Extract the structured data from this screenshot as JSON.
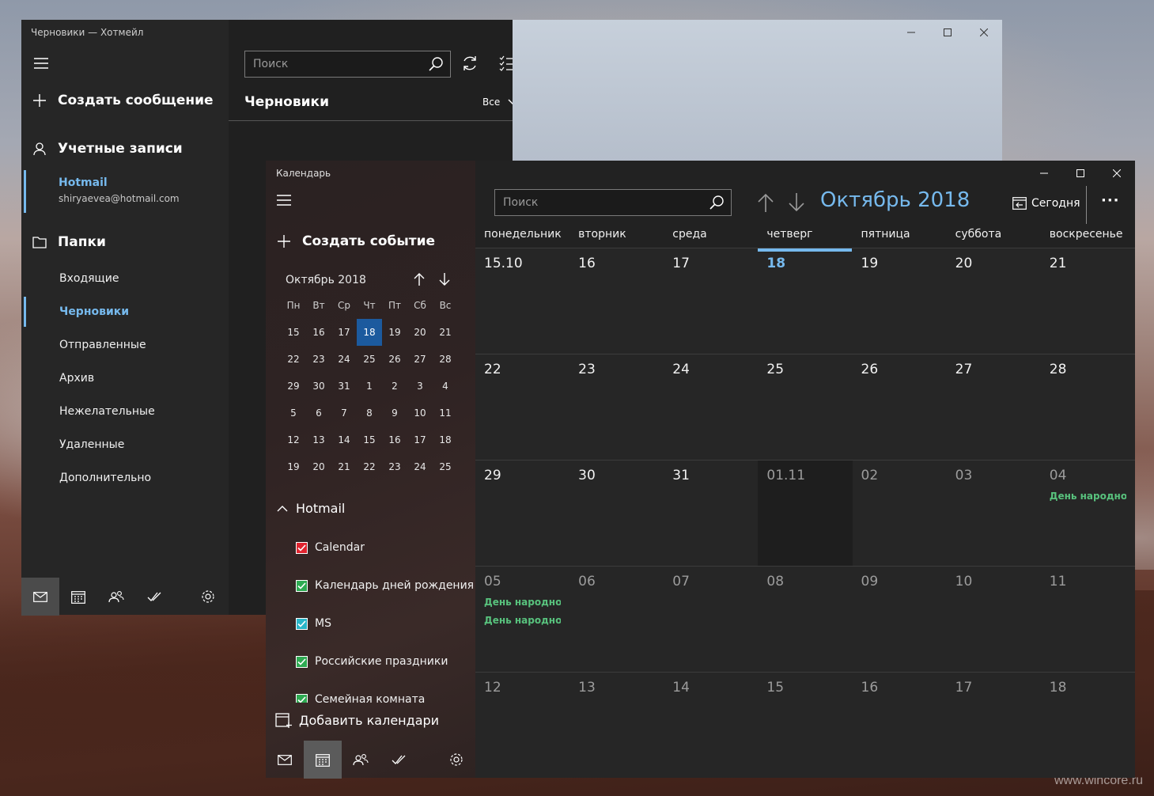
{
  "watermark": "www.wincore.ru",
  "mail": {
    "window_title": "Черновики — Хотмейл",
    "compose_label": "Создать сообщение",
    "accounts_label": "Учетные записи",
    "account": {
      "name": "Hotmail",
      "email": "shiryaevea@hotmail.com"
    },
    "folders_label": "Папки",
    "folders": [
      {
        "label": "Входящие",
        "active": false
      },
      {
        "label": "Черновики",
        "active": true
      },
      {
        "label": "Отправленные",
        "active": false
      },
      {
        "label": "Архив",
        "active": false
      },
      {
        "label": "Нежелательные",
        "active": false
      },
      {
        "label": "Удаленные",
        "active": false
      },
      {
        "label": "Дополнительно",
        "active": false
      }
    ],
    "search_placeholder": "Поиск",
    "folder_title": "Черновики",
    "filter_label": "Все"
  },
  "calendar": {
    "window_title": "Календарь",
    "new_event_label": "Создать событие",
    "mini": {
      "month_label": "Октябрь 2018",
      "weekday_heads": [
        "Пн",
        "Вт",
        "Ср",
        "Чт",
        "Пт",
        "Сб",
        "Вс"
      ],
      "weeks": [
        [
          "15",
          "16",
          "17",
          "18",
          "19",
          "20",
          "21"
        ],
        [
          "22",
          "23",
          "24",
          "25",
          "26",
          "27",
          "28"
        ],
        [
          "29",
          "30",
          "31",
          "1",
          "2",
          "3",
          "4"
        ],
        [
          "5",
          "6",
          "7",
          "8",
          "9",
          "10",
          "11"
        ],
        [
          "12",
          "13",
          "14",
          "15",
          "16",
          "17",
          "18"
        ],
        [
          "19",
          "20",
          "21",
          "22",
          "23",
          "24",
          "25"
        ]
      ],
      "today": "18"
    },
    "group_label": "Hotmail",
    "calendars": [
      {
        "label": "Calendar",
        "color": "#e0242f"
      },
      {
        "label": "Календарь дней рождения",
        "color": "#2eaa52"
      },
      {
        "label": "MS",
        "color": "#2ab6c9"
      },
      {
        "label": "Российские праздники",
        "color": "#2eaa52"
      },
      {
        "label": "Семейная комната",
        "color": "#2eaa52"
      }
    ],
    "add_calendars_label": "Добавить календари",
    "search_placeholder": "Поиск",
    "month_title": "Октябрь 2018",
    "today_label": "Сегодня",
    "weekdays": [
      "понедельник",
      "вторник",
      "среда",
      "четверг",
      "пятница",
      "суббота",
      "воскресенье"
    ],
    "today_col": 3,
    "weeks": [
      [
        {
          "d": "15.10"
        },
        {
          "d": "16"
        },
        {
          "d": "17"
        },
        {
          "d": "18",
          "today": true
        },
        {
          "d": "19"
        },
        {
          "d": "20"
        },
        {
          "d": "21"
        }
      ],
      [
        {
          "d": "22"
        },
        {
          "d": "23"
        },
        {
          "d": "24"
        },
        {
          "d": "25"
        },
        {
          "d": "26"
        },
        {
          "d": "27"
        },
        {
          "d": "28"
        }
      ],
      [
        {
          "d": "29"
        },
        {
          "d": "30"
        },
        {
          "d": "31"
        },
        {
          "d": "01.11",
          "other": true,
          "dim": true
        },
        {
          "d": "02",
          "other": true
        },
        {
          "d": "03",
          "other": true
        },
        {
          "d": "04",
          "other": true,
          "events": [
            "День народного единства"
          ]
        }
      ],
      [
        {
          "d": "05",
          "other": true,
          "events": [
            "День народного единства",
            "День народного"
          ]
        },
        {
          "d": "06",
          "other": true
        },
        {
          "d": "07",
          "other": true
        },
        {
          "d": "08",
          "other": true
        },
        {
          "d": "09",
          "other": true
        },
        {
          "d": "10",
          "other": true
        },
        {
          "d": "11",
          "other": true
        }
      ],
      [
        {
          "d": "12",
          "other": true
        },
        {
          "d": "13",
          "other": true
        },
        {
          "d": "14",
          "other": true
        },
        {
          "d": "15",
          "other": true
        },
        {
          "d": "16",
          "other": true
        },
        {
          "d": "17",
          "other": true
        },
        {
          "d": "18",
          "other": true
        }
      ]
    ],
    "accent": "#76b9ed",
    "event_color": "#58c27d"
  }
}
